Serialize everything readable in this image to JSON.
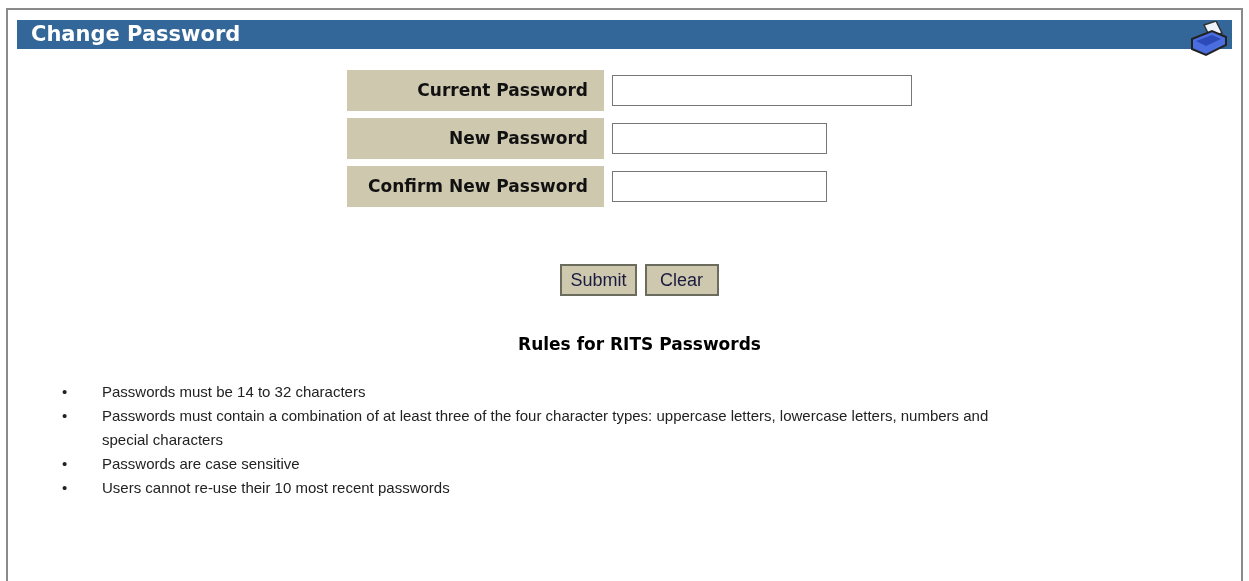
{
  "header": {
    "title": "Change Password"
  },
  "fields": [
    {
      "label": "Current Password",
      "wide": true
    },
    {
      "label": "New Password",
      "wide": false
    },
    {
      "label": "Confirm New Password",
      "wide": false
    }
  ],
  "buttons": [
    "Submit",
    "Clear"
  ],
  "rules_title": "Rules for RITS Passwords",
  "rules": [
    {
      "bullet": "•",
      "text": "Passwords must be 14 to 32 characters"
    },
    {
      "bullet": "•",
      "text": "Passwords must contain a combination of at least three of the four character types: uppercase letters, lowercase letters, numbers and special characters"
    },
    {
      "bullet": "•",
      "text": "Passwords are case sensitive"
    },
    {
      "bullet": "•",
      "text": "Users cannot re-use their 10 most recent passwords"
    }
  ]
}
